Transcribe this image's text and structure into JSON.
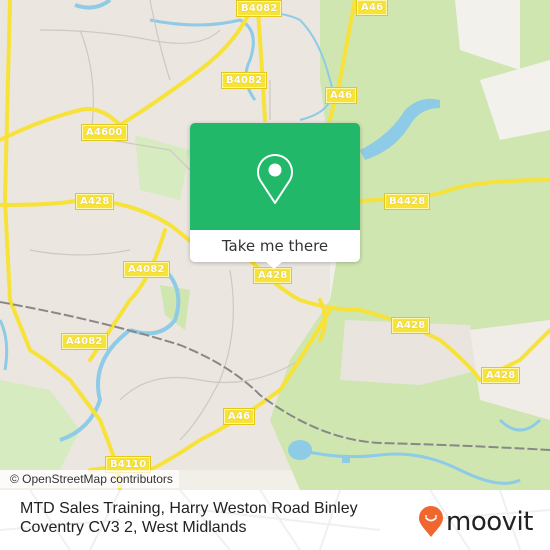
{
  "map": {
    "attribution": "© OpenStreetMap contributors",
    "road_labels": [
      {
        "id": "b4082-top",
        "text": "B4082"
      },
      {
        "id": "a46-top",
        "text": "A46"
      },
      {
        "id": "b4082-mid",
        "text": "B4082"
      },
      {
        "id": "a46-upper",
        "text": "A46"
      },
      {
        "id": "a4600",
        "text": "A4600"
      },
      {
        "id": "a428-west",
        "text": "A428"
      },
      {
        "id": "b4428",
        "text": "B4428"
      },
      {
        "id": "a4082-mid",
        "text": "A4082"
      },
      {
        "id": "a428-center",
        "text": "A428"
      },
      {
        "id": "a428-east",
        "text": "A428"
      },
      {
        "id": "a4082-west",
        "text": "A4082"
      },
      {
        "id": "a428-far-east",
        "text": "A428"
      },
      {
        "id": "a46-south",
        "text": "A46"
      },
      {
        "id": "b4110",
        "text": "B4110"
      }
    ],
    "colors": {
      "land": "#f2efe9",
      "residential": "#e6e1dc",
      "park": "#cfe6b0",
      "water": "#8ecbe6",
      "road_major": "#f7e23a",
      "railway": "#888888"
    }
  },
  "popup": {
    "button_label": "Take me there",
    "pin_icon": "map-pin-icon",
    "color": "#21b86a"
  },
  "footer": {
    "address": "MTD Sales Training, Harry Weston Road Binley Coventry CV3 2, West Midlands",
    "brand": "moovit",
    "brand_color": "#f1662f"
  }
}
